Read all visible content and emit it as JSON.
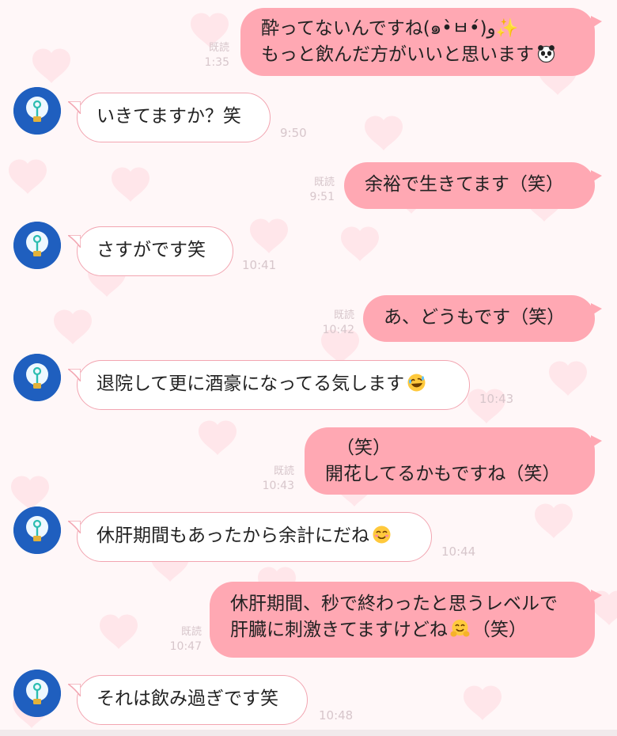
{
  "chat": {
    "messages": [
      {
        "direction": "outgoing",
        "read_label": "既読",
        "time": "1:35",
        "lines": [
          "酔ってないんですね(๑•̀ㅂ•́)و✨",
          "もっと飲んだ方がいいと思います"
        ],
        "emoji_end": "panda-emoji"
      },
      {
        "direction": "incoming",
        "time": "9:50",
        "lines": [
          "いきてますか？笑"
        ]
      },
      {
        "direction": "outgoing",
        "read_label": "既読",
        "time": "9:51",
        "lines": [
          "余裕で生きてます（笑）"
        ]
      },
      {
        "direction": "incoming",
        "time": "10:41",
        "lines": [
          "さすがです笑"
        ]
      },
      {
        "direction": "outgoing",
        "read_label": "既読",
        "time": "10:42",
        "lines": [
          "あ、どうもです（笑）"
        ]
      },
      {
        "direction": "incoming",
        "time": "10:43",
        "lines": [
          "退院して更に酒豪になってる気します"
        ],
        "emoji_end": "rolling-laughing-emoji"
      },
      {
        "direction": "outgoing",
        "read_label": "既読",
        "time": "10:43",
        "lines": [
          "（笑）",
          "開花してるかもですね（笑）"
        ]
      },
      {
        "direction": "incoming",
        "time": "10:44",
        "lines": [
          "休肝期間もあったから余計にだね"
        ],
        "emoji_end": "smiling-blush-emoji"
      },
      {
        "direction": "outgoing",
        "read_label": "既読",
        "time": "10:47",
        "lines": [
          "休肝期間、秒で終わったと思うレベルで",
          "肝臓に刺激きてますけどね",
          "（笑）"
        ],
        "emoji_mid": "hugging-face-emoji"
      },
      {
        "direction": "incoming",
        "time": "10:48",
        "lines": [
          "それは飲み過ぎです笑"
        ]
      }
    ]
  },
  "colors": {
    "outgoing_bubble": "#ffa8b3",
    "incoming_border": "#f2a5b1",
    "background": "#fff7f8",
    "heart": "#ffe6ea",
    "avatar": "#1f5fbf",
    "meta_text": "#d7c6cb"
  }
}
